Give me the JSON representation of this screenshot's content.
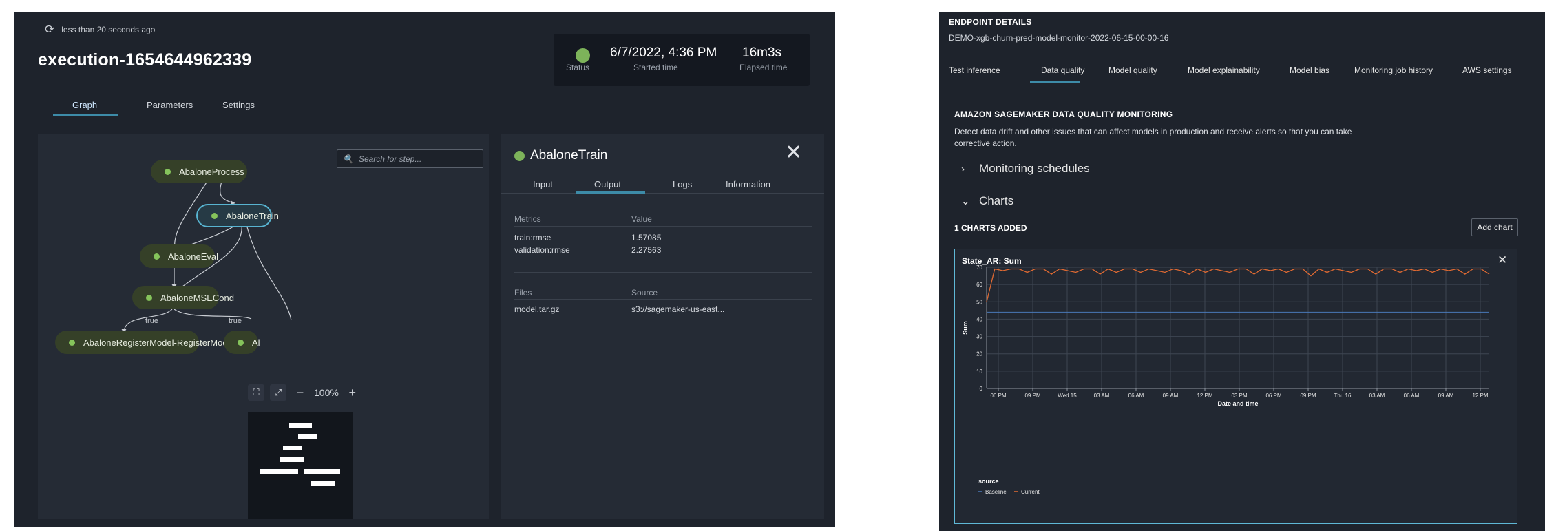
{
  "left": {
    "refresh_text": "less than 20 seconds ago",
    "execution_title": "execution-1654644962339",
    "status": {
      "dot_color": "#7db35a",
      "status_label": "Status",
      "started_value": "6/7/2022, 4:36 PM",
      "started_label": "Started time",
      "elapsed_value": "16m3s",
      "elapsed_label": "Elapsed time"
    },
    "tabs": [
      "Graph",
      "Parameters",
      "Settings"
    ],
    "graph": {
      "search_placeholder": "Search for step...",
      "nodes": {
        "process": "AbaloneProcess",
        "train": "AbaloneTrain",
        "eval": "AbaloneEval",
        "msecond": "AbaloneMSECond",
        "register": "AbaloneRegisterModel-RegisterModel",
        "partial": "Al"
      },
      "edge_labels": [
        "true",
        "true"
      ],
      "zoom": "100%"
    },
    "detail": {
      "title": "AbaloneTrain",
      "tabs": [
        "Input",
        "Output",
        "Logs",
        "Information"
      ],
      "metrics_header": [
        "Metrics",
        "Value"
      ],
      "metrics": [
        {
          "name": "train:rmse",
          "value": "1.57085"
        },
        {
          "name": "validation:rmse",
          "value": "2.27563"
        }
      ],
      "files_header": [
        "Files",
        "Source"
      ],
      "files": [
        {
          "name": "model.tar.gz",
          "source": "s3://sagemaker-us-east..."
        }
      ]
    }
  },
  "right": {
    "endpoint_heading": "ENDPOINT DETAILS",
    "endpoint_name": "DEMO-xgb-churn-pred-model-monitor-2022-06-15-00-00-16",
    "tabs": [
      "Test inference",
      "Data quality",
      "Model quality",
      "Model explainability",
      "Model bias",
      "Monitoring job history",
      "AWS settings"
    ],
    "section_title": "AMAZON SAGEMAKER DATA QUALITY MONITORING",
    "description": "Detect data drift and other issues that can affect models in production and receive alerts so that you can take corrective action.",
    "accordion_monitoring": "Monitoring schedules",
    "accordion_charts": "Charts",
    "charts_added": "1 CHARTS ADDED",
    "add_chart_button": "Add chart",
    "chart_card_title": "State_AR: Sum"
  },
  "chart_data": {
    "type": "line",
    "title": "State_AR: Sum",
    "xlabel": "Date and time",
    "ylabel": "Sum",
    "ylim": [
      0,
      70
    ],
    "yticks": [
      0,
      10,
      20,
      30,
      40,
      50,
      60,
      70
    ],
    "x_tick_labels": [
      "06 PM",
      "09 PM",
      "Wed 15",
      "03 AM",
      "06 AM",
      "09 AM",
      "12 PM",
      "03 PM",
      "06 PM",
      "09 PM",
      "Thu 16",
      "03 AM",
      "06 AM",
      "09 AM",
      "12 PM"
    ],
    "legend_title": "source",
    "legend_position": "bottom-left",
    "grid": true,
    "series": [
      {
        "name": "Baseline",
        "color": "#4a78b8",
        "values": [
          44,
          44
        ]
      },
      {
        "name": "Current",
        "color": "#e06a32",
        "values": [
          50,
          69,
          68,
          69,
          69,
          67,
          69,
          69,
          66,
          69,
          68,
          67,
          69,
          69,
          66,
          69,
          67,
          69,
          69,
          67,
          69,
          68,
          67,
          69,
          68,
          66,
          69,
          67,
          69,
          68,
          67,
          69,
          69,
          66,
          69,
          68,
          69,
          67,
          69,
          69,
          65,
          69,
          67,
          69,
          68,
          67,
          69,
          69,
          66,
          69,
          69,
          67,
          69,
          68,
          69,
          67,
          69,
          68,
          69,
          66,
          69,
          69,
          66
        ]
      }
    ]
  }
}
